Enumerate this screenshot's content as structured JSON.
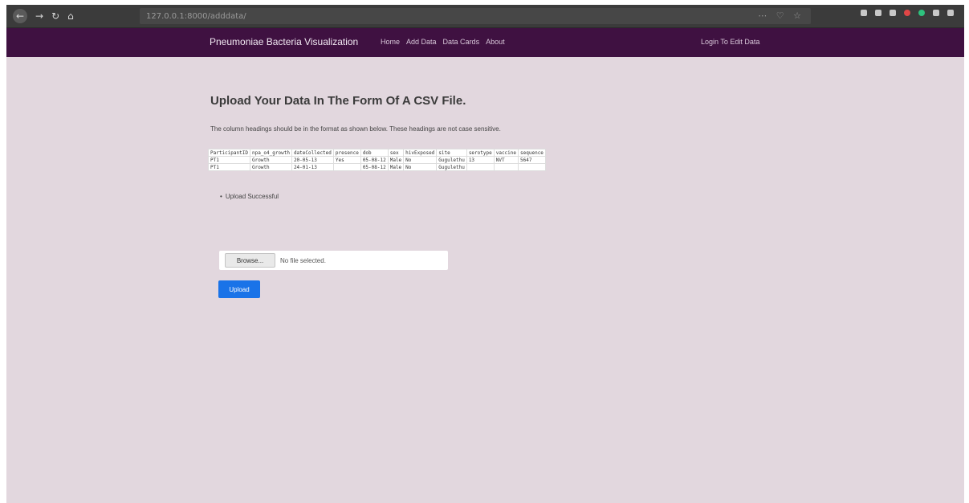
{
  "browser": {
    "url": "127.0.0.1:8000/adddata/"
  },
  "navbar": {
    "brand": "Pneumoniae Bacteria Visualization",
    "links": [
      "Home",
      "Add Data",
      "Data Cards",
      "About"
    ],
    "login": "Login To Edit Data"
  },
  "page": {
    "title": "Upload Your Data In The Form Of A CSV File.",
    "subtitle": "The column headings should be in the format as shown below. These headings are not case sensitive.",
    "table": {
      "headers": [
        "ParticipantID",
        "npa_o4_growth",
        "dateCollected",
        "presence",
        "dob",
        "sex",
        "hivExposed",
        "site",
        "serotype",
        "vaccine",
        "sequence"
      ],
      "rows": [
        [
          "PT1",
          "Growth",
          "20-05-13",
          "Yes",
          "05-08-12",
          "Male",
          "No",
          "Gugulethu",
          "13",
          "NVT",
          "5647"
        ],
        [
          "PT1",
          "Growth",
          "24-01-13",
          "",
          "05-08-12",
          "Male",
          "No",
          "Gugulethu",
          "",
          "",
          ""
        ]
      ]
    },
    "messages": [
      "Upload Successful"
    ],
    "file_input": {
      "browse_label": "Browse...",
      "status": "No file selected."
    },
    "upload_label": "Upload"
  },
  "colors": {
    "navbar": "#3f1141",
    "background": "#e2d7de",
    "upload_button": "#1a73e8"
  }
}
